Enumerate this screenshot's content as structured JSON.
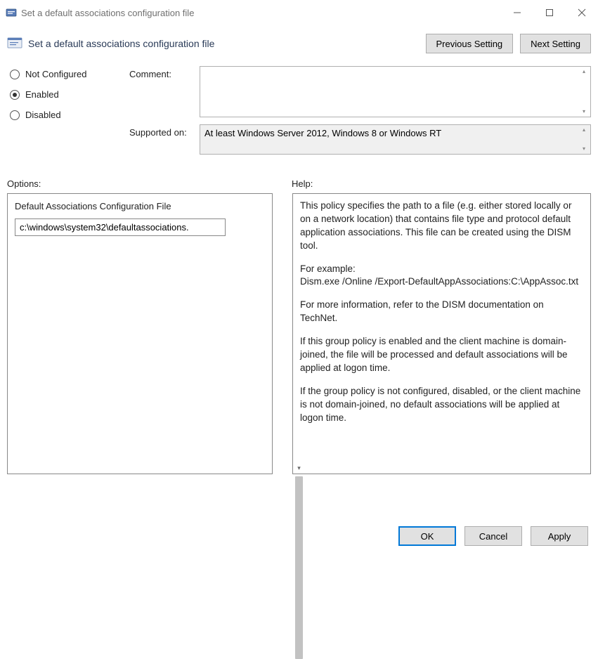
{
  "titlebar": {
    "title": "Set a default associations configuration file"
  },
  "header": {
    "policy_title": "Set a default associations configuration file",
    "prev_btn": "Previous Setting",
    "next_btn": "Next Setting"
  },
  "state": {
    "not_configured": "Not Configured",
    "enabled": "Enabled",
    "disabled": "Disabled",
    "selected": "enabled"
  },
  "comment": {
    "label": "Comment:",
    "value": ""
  },
  "supported": {
    "label": "Supported on:",
    "value": "At least Windows Server 2012, Windows 8 or Windows RT"
  },
  "sections": {
    "options": "Options:",
    "help": "Help:"
  },
  "options": {
    "field_label": "Default Associations Configuration File",
    "field_value": "c:\\windows\\system32\\defaultassociations."
  },
  "help": {
    "p1": "This policy specifies the path to a file (e.g. either stored locally or on a network location) that contains file type and protocol default application associations. This file can be created using the DISM tool.",
    "p2a": "For example:",
    "p2b": "Dism.exe /Online /Export-DefaultAppAssociations:C:\\AppAssoc.txt",
    "p3": "For more information, refer to the DISM documentation on TechNet.",
    "p4": "If this group policy is enabled and the client machine is domain-joined, the file will be processed and default associations will be applied at logon time.",
    "p5": "If the group policy is not configured, disabled, or the client machine is not domain-joined, no default associations will be applied at logon time."
  },
  "footer": {
    "ok": "OK",
    "cancel": "Cancel",
    "apply": "Apply"
  }
}
